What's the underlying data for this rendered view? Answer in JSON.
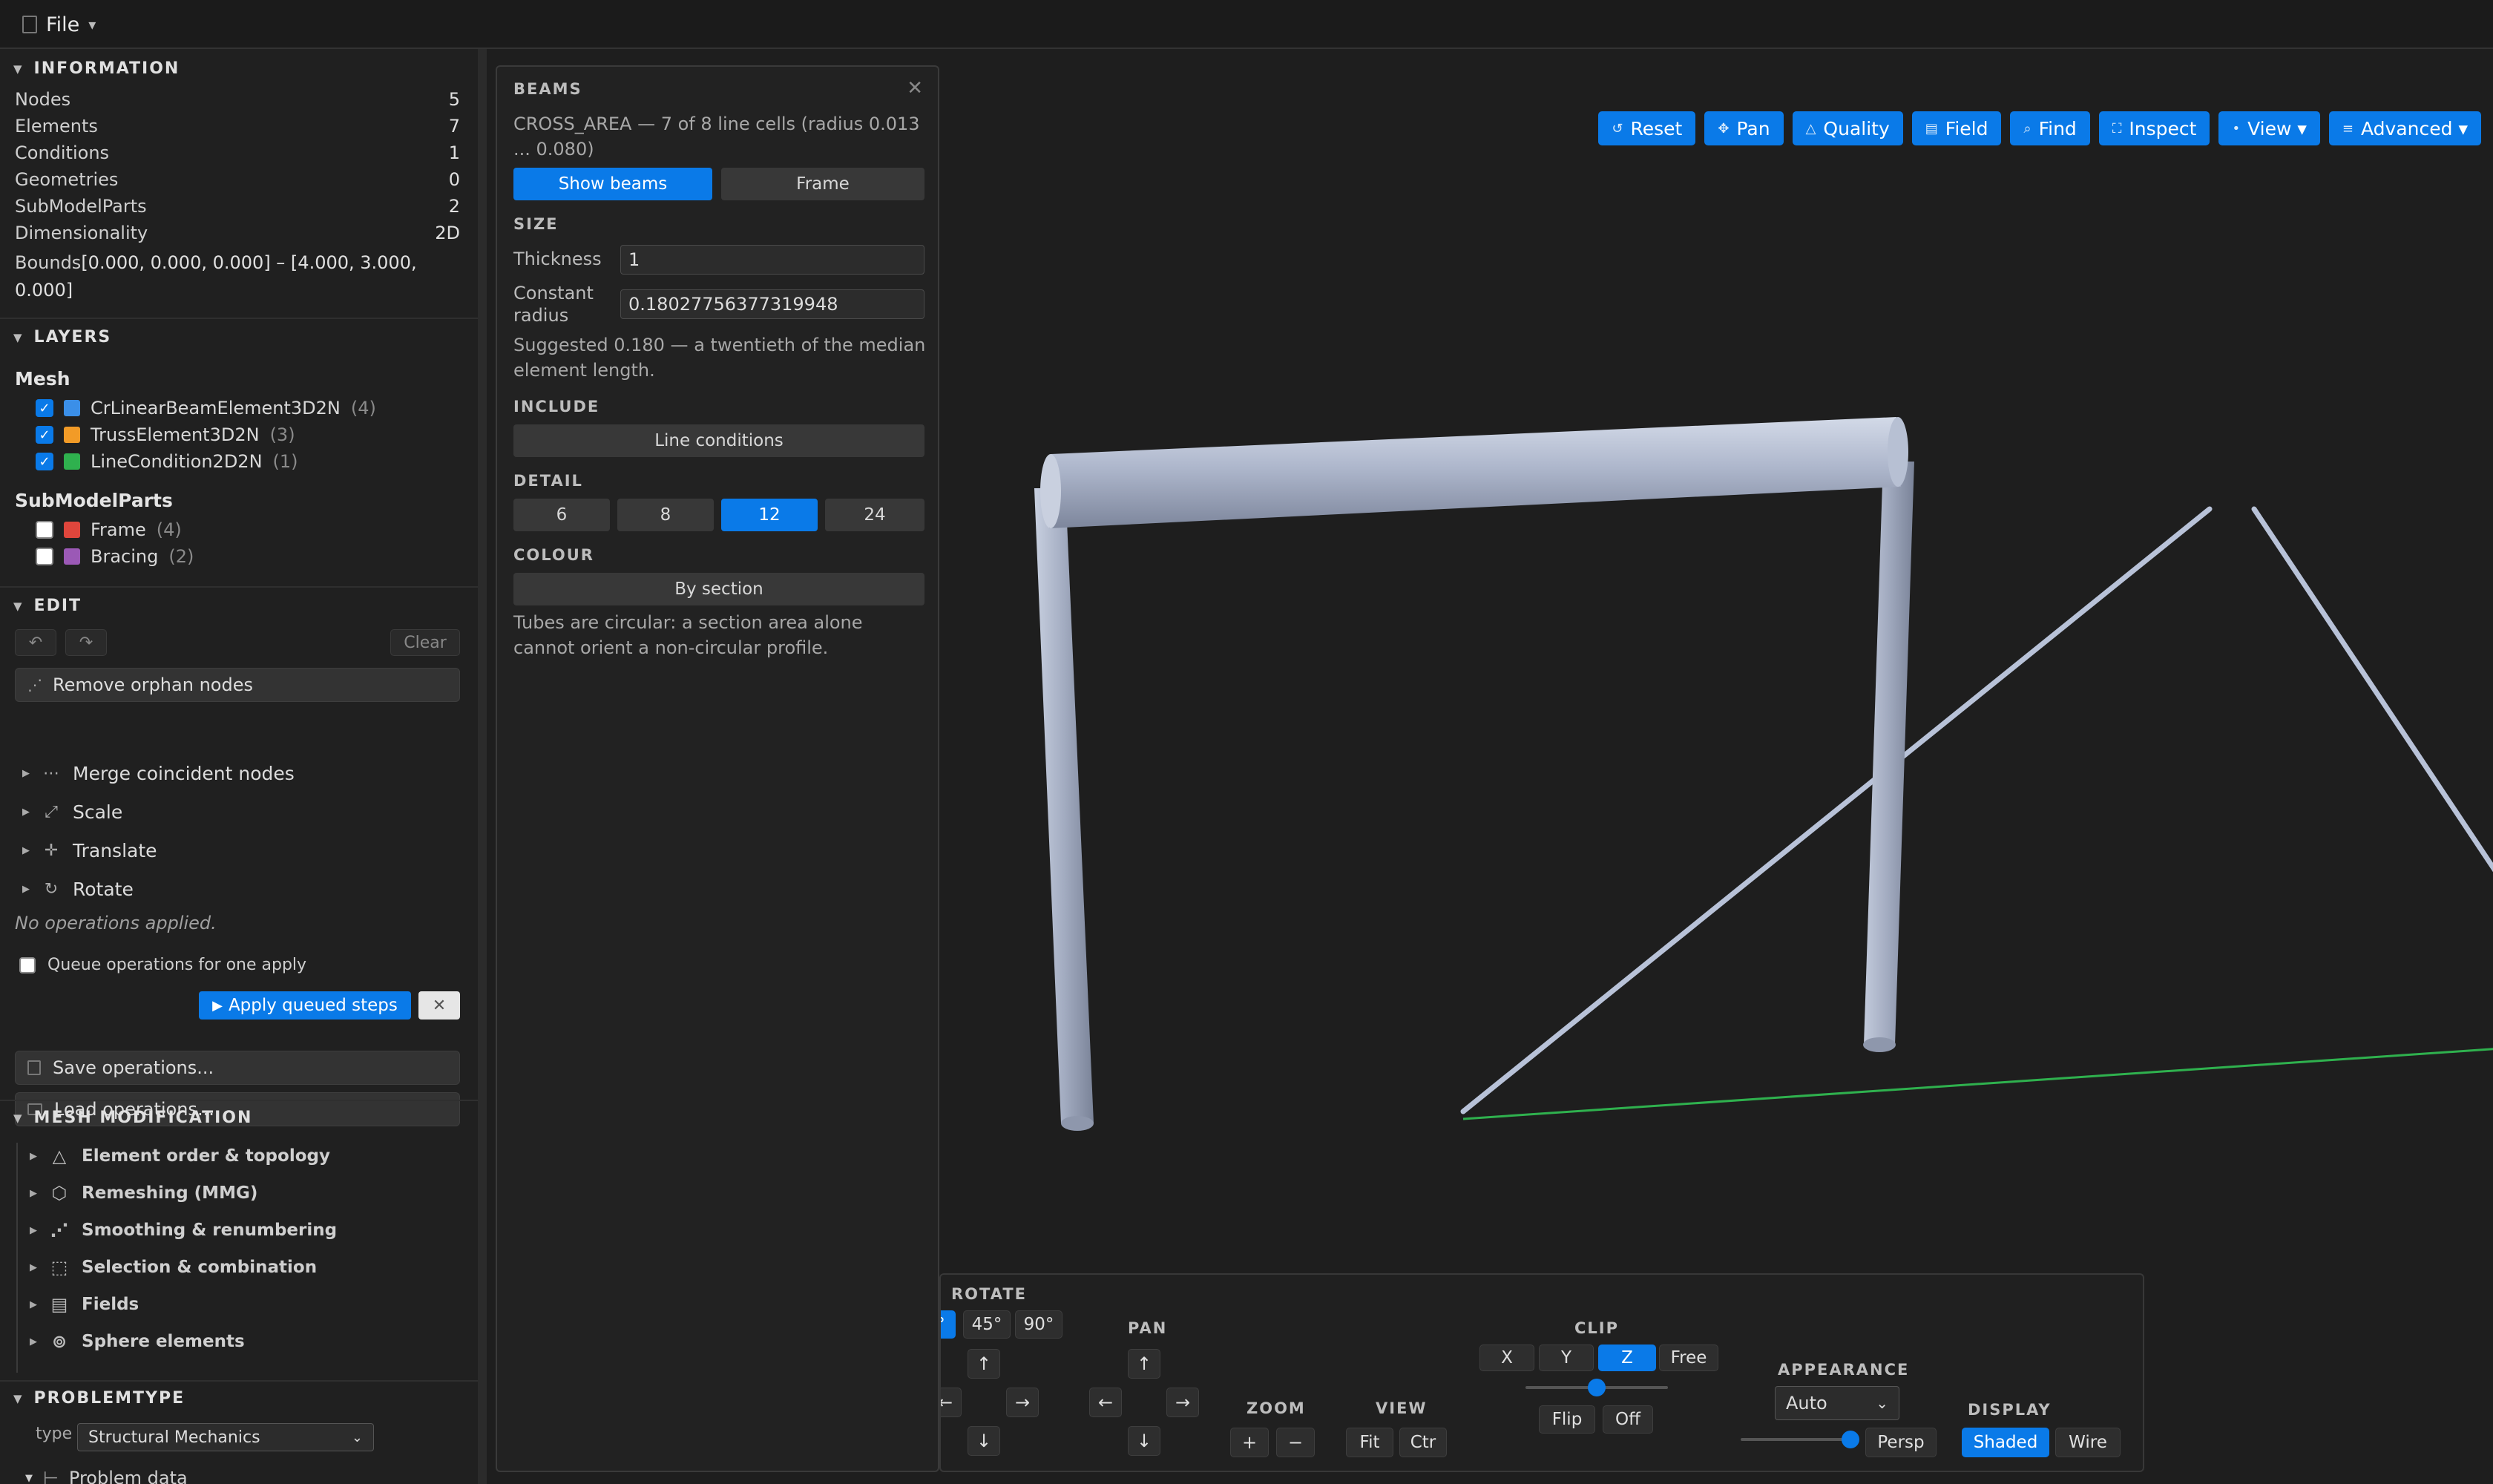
{
  "menubar": {
    "file_label": "File",
    "file_icon": "document-icon",
    "caret": "▾"
  },
  "information": {
    "title": "INFORMATION",
    "rows": [
      {
        "label": "Nodes",
        "value": "5"
      },
      {
        "label": "Elements",
        "value": "7"
      },
      {
        "label": "Conditions",
        "value": "1"
      },
      {
        "label": "Geometries",
        "value": "0"
      },
      {
        "label": "SubModelParts",
        "value": "2"
      },
      {
        "label": "Dimensionality",
        "value": "2D"
      }
    ],
    "bounds_label": "Bounds",
    "bounds_value": "[0.000, 0.000, 0.000] – [4.000, 3.000, 0.000]"
  },
  "layers": {
    "title": "LAYERS",
    "mesh_title": "Mesh",
    "mesh": [
      {
        "name": "CrLinearBeamElement3D2N",
        "count": "(4)",
        "color": "#3b8fe8",
        "checked": true
      },
      {
        "name": "TrussElement3D2N",
        "count": "(3)",
        "color": "#f29b27",
        "checked": true
      },
      {
        "name": "LineCondition2D2N",
        "count": "(1)",
        "color": "#2fb14e",
        "checked": true
      }
    ],
    "smp_title": "SubModelParts",
    "smp": [
      {
        "name": "Frame",
        "count": "(4)",
        "color": "#e0463c",
        "checked": false
      },
      {
        "name": "Bracing",
        "count": "(2)",
        "color": "#9b59b6",
        "checked": false
      }
    ]
  },
  "edit": {
    "title": "EDIT",
    "undo_icon": "undo-icon",
    "redo_icon": "redo-icon",
    "clear_label": "Clear",
    "remove_orphan_label": "Remove orphan nodes",
    "ops": [
      {
        "label": "Merge coincident nodes",
        "icon": "merge-icon"
      },
      {
        "label": "Scale",
        "icon": "scale-icon"
      },
      {
        "label": "Translate",
        "icon": "translate-icon"
      },
      {
        "label": "Rotate",
        "icon": "rotate-icon"
      }
    ],
    "no_ops_text": "No operations applied.",
    "queue_label": "Queue operations for one apply",
    "apply_label": "Apply queued steps",
    "save_label": "Save operations...",
    "load_label": "Load operations..."
  },
  "mesh_modification": {
    "title": "MESH MODIFICATION",
    "items": [
      {
        "label": "Element order & topology",
        "icon": "triangle-icon"
      },
      {
        "label": "Remeshing (MMG)",
        "icon": "remesh-icon"
      },
      {
        "label": "Smoothing & renumbering",
        "icon": "smoothing-icon"
      },
      {
        "label": "Selection & combination",
        "icon": "selection-icon"
      },
      {
        "label": "Fields",
        "icon": "fields-icon"
      },
      {
        "label": "Sphere elements",
        "icon": "sphere-icon"
      }
    ]
  },
  "problemtype": {
    "title": "PROBLEMTYPE",
    "type_label": "type",
    "type_value": "Structural Mechanics",
    "problem_data_label": "Problem data"
  },
  "beams": {
    "title": "BEAMS",
    "subtitle": "CROSS_AREA — 7 of 8 line cells (radius 0.013 ... 0.080)",
    "show_beams_label": "Show beams",
    "frame_label": "Frame",
    "size_title": "SIZE",
    "thickness_label": "Thickness",
    "thickness_value": "1",
    "radius_label_1": "Constant",
    "radius_label_2": "radius",
    "radius_value": "0.18027756377319948",
    "suggestion": "Suggested 0.180 — a twentieth of the median element length.",
    "include_title": "INCLUDE",
    "line_conditions_label": "Line conditions",
    "detail_title": "DETAIL",
    "detail_options": [
      "6",
      "8",
      "12",
      "24"
    ],
    "detail_selected": "12",
    "colour_title": "COLOUR",
    "colour_value": "By section",
    "note": "Tubes are circular: a section area alone cannot orient a non-circular profile."
  },
  "toolbar": [
    {
      "label": "Reset",
      "icon": "reset-icon",
      "glyph": "↺"
    },
    {
      "label": "Pan",
      "icon": "pan-icon",
      "glyph": "✥"
    },
    {
      "label": "Quality",
      "icon": "quality-icon",
      "glyph": "△"
    },
    {
      "label": "Field",
      "icon": "field-icon",
      "glyph": "▤"
    },
    {
      "label": "Find",
      "icon": "find-icon",
      "glyph": "⌕"
    },
    {
      "label": "Inspect",
      "icon": "inspect-icon",
      "glyph": "⛶"
    },
    {
      "label": "View ▾",
      "icon": "view-icon",
      "glyph": "•"
    },
    {
      "label": "Advanced ▾",
      "icon": "advanced-icon",
      "glyph": "≡"
    }
  ],
  "controls": {
    "rotate_title": "ROTATE",
    "rotate_partial": "°",
    "rotate_45": "45°",
    "rotate_90": "90°",
    "pan_title": "PAN",
    "zoom_title": "ZOOM",
    "zoom_in": "+",
    "zoom_out": "−",
    "view_title": "VIEW",
    "view_fit": "Fit",
    "view_ctr": "Ctr",
    "clip_title": "CLIP",
    "clip_axes": [
      "X",
      "Y",
      "Z",
      "Free"
    ],
    "clip_selected": "Z",
    "clip_flip": "Flip",
    "clip_off": "Off",
    "appearance_title": "APPEARANCE",
    "appearance_value": "Auto",
    "persp_label": "Persp",
    "display_title": "DISPLAY",
    "display_shaded": "Shaded",
    "display_wire": "Wire",
    "arrow_up": "↑",
    "arrow_down": "↓",
    "arrow_left": "←",
    "arrow_right": "→"
  },
  "colors": {
    "accent": "#0a7ae8",
    "beam": "#a9b3cc",
    "condition_line": "#2fb14e"
  }
}
